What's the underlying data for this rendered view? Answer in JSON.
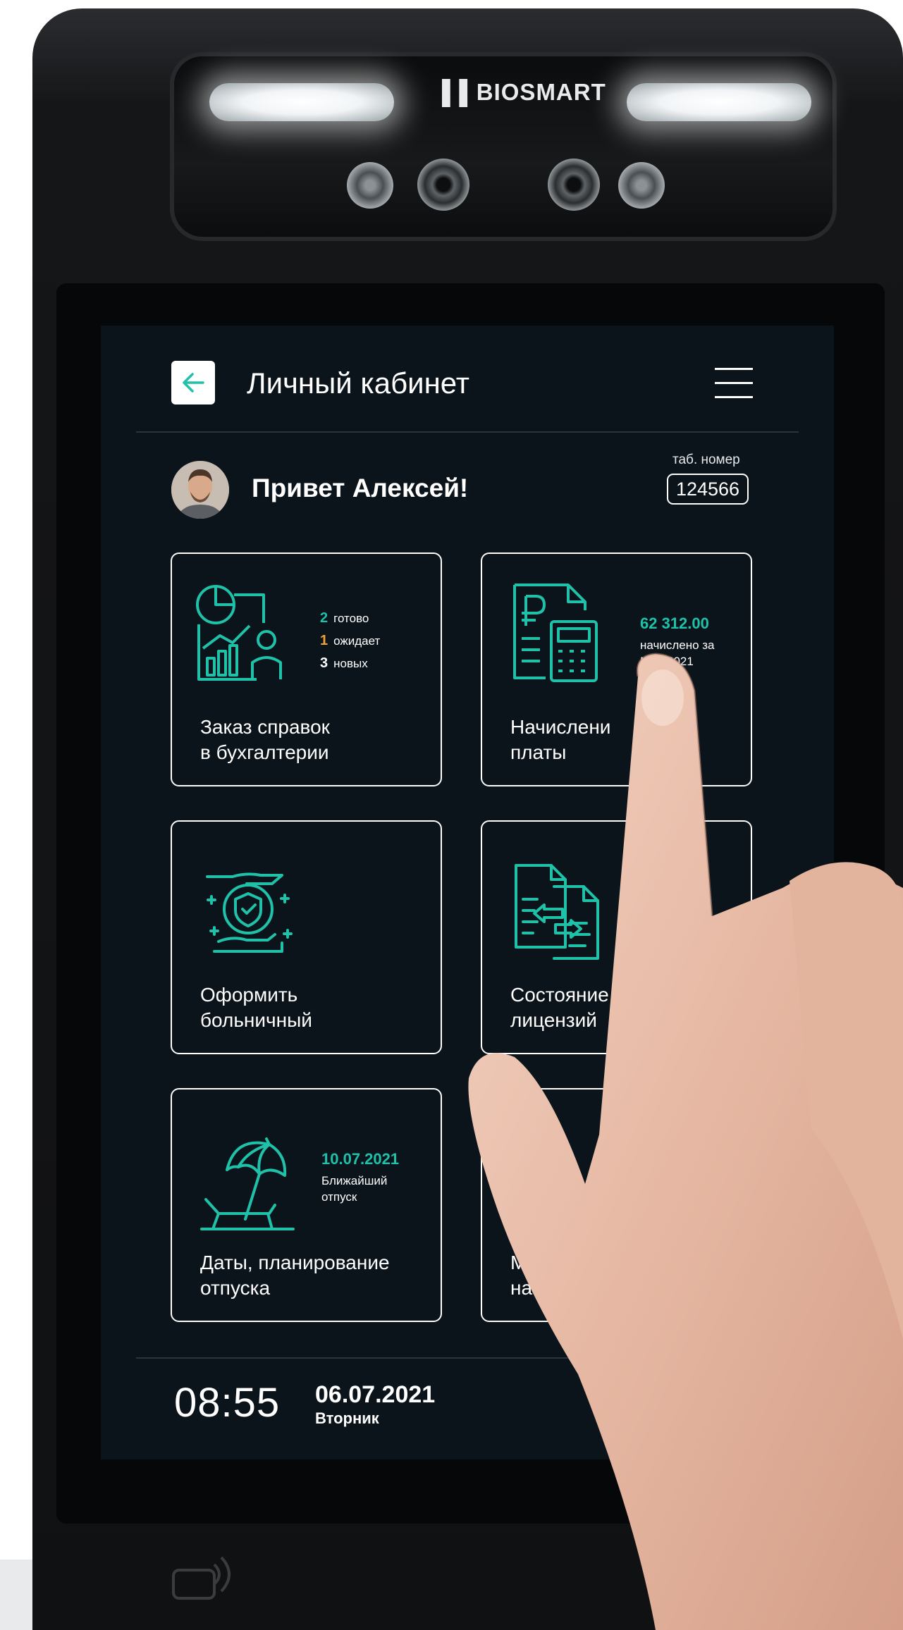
{
  "device": {
    "brand": "BIOSMART"
  },
  "header": {
    "title": "Личный кабинет"
  },
  "user": {
    "greeting": "Привет Алексей!",
    "tab_label": "таб. номер",
    "tab_number": "124566"
  },
  "cards": {
    "references": {
      "label": "Заказ справок\nв бухгалтерии",
      "stats": [
        {
          "count": "2",
          "text": "готово",
          "color": "#1fc1a9"
        },
        {
          "count": "1",
          "text": "ожидает",
          "color": "#f0a137"
        },
        {
          "count": "3",
          "text": "новых",
          "color": "#ffffff"
        }
      ]
    },
    "salary": {
      "label": "Начислени\nплаты",
      "amount": "62 312.00",
      "note": "начислено за\nМай 2021"
    },
    "sick_leave": {
      "label": "Оформить\nбольничный"
    },
    "licenses": {
      "label": "Состояние сп\nлицензий"
    },
    "vacation": {
      "label": "Даты, планирование\nотпуска",
      "date": "10.07.2021",
      "note": "Ближайший\nотпуск"
    },
    "hidden": {
      "label": "М\nна"
    }
  },
  "footer": {
    "time": "08:55",
    "date": "06.07.2021",
    "weekday": "Вторник"
  },
  "colors": {
    "accent": "#1fc1a9",
    "background": "#0c141b",
    "pending": "#f0a137"
  }
}
